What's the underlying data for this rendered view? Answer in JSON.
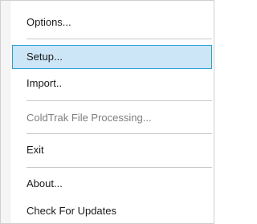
{
  "menu": {
    "items": [
      {
        "label": "Options..."
      },
      {
        "label": "Setup..."
      },
      {
        "label": "Import.."
      },
      {
        "label": "ColdTrak File Processing..."
      },
      {
        "label": "Exit"
      },
      {
        "label": "About..."
      },
      {
        "label": "Check For Updates"
      }
    ],
    "selected_item": "Setup...",
    "disabled_item": "ColdTrak File Processing..."
  },
  "colors": {
    "selection_fill": "#cde6f7",
    "selection_border": "#26a0da",
    "disabled_text": "#7d7d7d"
  }
}
